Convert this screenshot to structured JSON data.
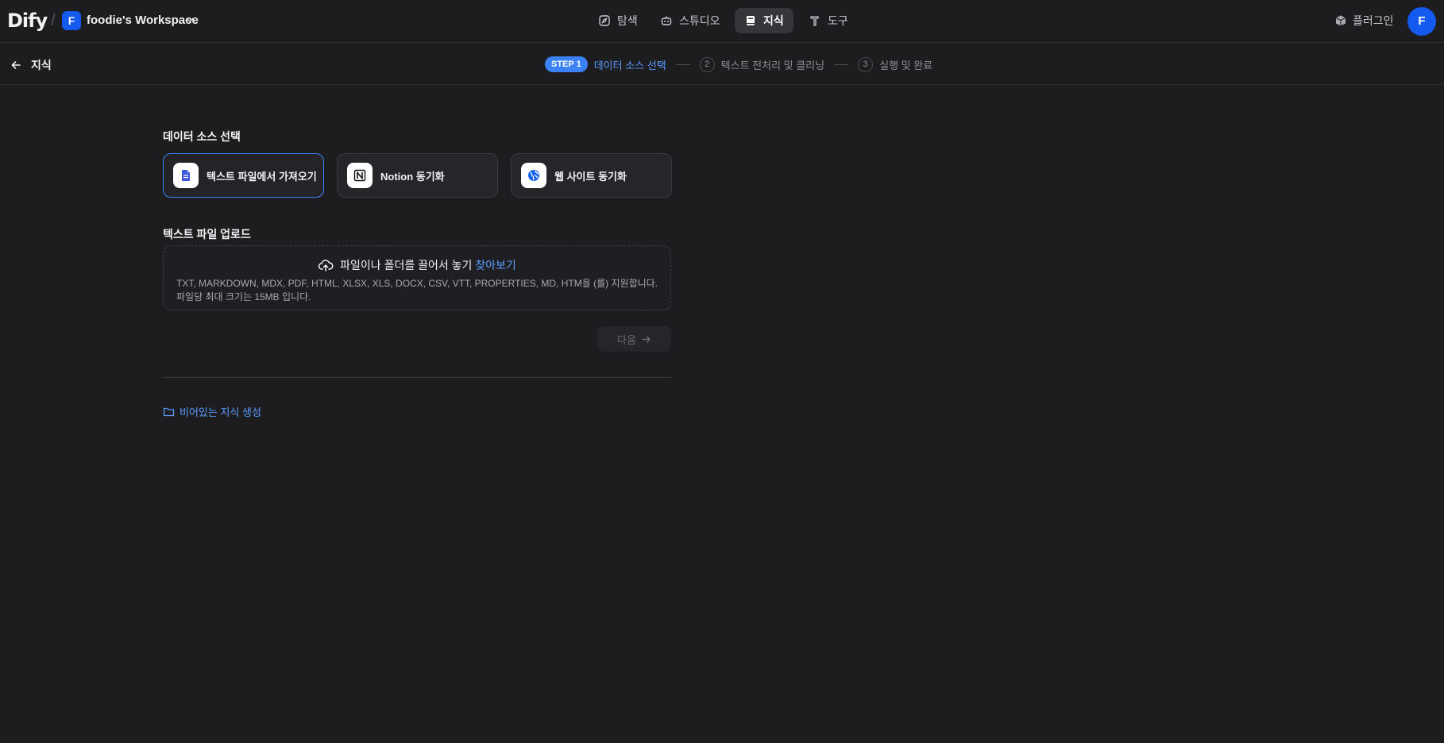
{
  "header": {
    "logo": "Dify",
    "workspace": {
      "initial": "F",
      "name": "foodie's Workspace"
    },
    "tabs": [
      {
        "label": "탐색",
        "icon": "compass-icon",
        "active": false
      },
      {
        "label": "스튜디오",
        "icon": "robot-icon",
        "active": false
      },
      {
        "label": "지식",
        "icon": "book-icon",
        "active": true
      },
      {
        "label": "도구",
        "icon": "hammer-icon",
        "active": false
      }
    ],
    "plugin_label": "플러그인",
    "avatar_initial": "F"
  },
  "subheader": {
    "back_label": "지식",
    "steps": [
      {
        "badge": "STEP 1",
        "label": "데이터 소스 선택",
        "active": true
      },
      {
        "number": "2",
        "label": "텍스트 전처리 및 클리닝",
        "active": false
      },
      {
        "number": "3",
        "label": "실행 및 완료",
        "active": false
      }
    ]
  },
  "main": {
    "source_title": "데이터 소스 선택",
    "sources": [
      {
        "label": "텍스트 파일에서 가져오기",
        "icon": "file-icon",
        "selected": true
      },
      {
        "label": "Notion 동기화",
        "icon": "notion-icon",
        "selected": false
      },
      {
        "label": "웹 사이트 동기화",
        "icon": "globe-icon",
        "selected": false
      }
    ],
    "upload_title": "텍스트 파일 업로드",
    "dropzone": {
      "prompt": "파일이나 폴더를 끌어서 놓기",
      "browse": "찾아보기",
      "types": "TXT, MARKDOWN, MDX, PDF, HTML, XLSX, XLS, DOCX, CSV, VTT, PROPERTIES, MD, HTM을 (를) 지원합니다.",
      "size": "파일당 최대 크기는 15MB 입니다."
    },
    "next_label": "다음",
    "empty_link": "비어있는 지식 생성"
  },
  "colors": {
    "accent": "#3b82f6",
    "link": "#5b9cff",
    "background": "#1d1d20"
  }
}
